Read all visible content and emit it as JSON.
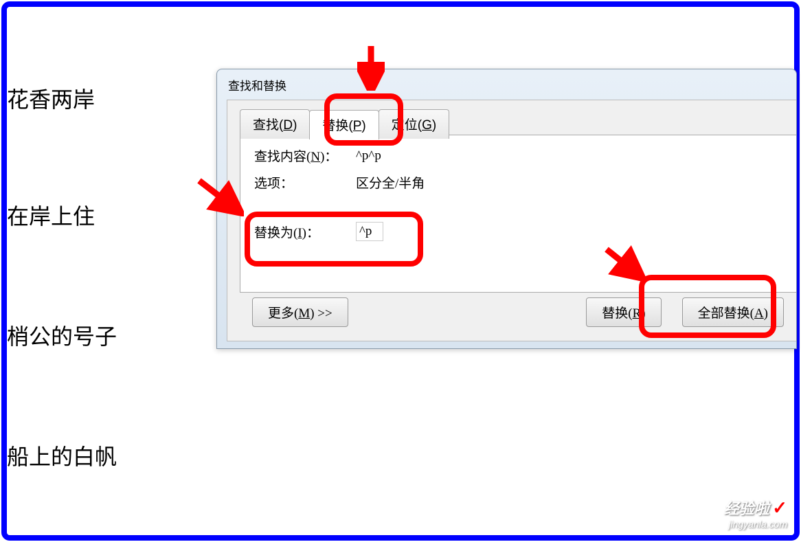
{
  "background_lines": {
    "line1": "花香两岸",
    "line2": "在岸上住",
    "line3": "梢公的号子",
    "line4": "船上的白帆"
  },
  "dialog": {
    "title": "查找和替换",
    "tabs": {
      "find": "查找(D)",
      "replace": "替换(P)",
      "goto": "定位(G)"
    },
    "labels": {
      "find_content": "查找内容(N)：",
      "options": "选项：",
      "replace_with": "替换为(I)："
    },
    "values": {
      "find_content": "^p^p",
      "options": "区分全/半角",
      "replace_with": "^p"
    },
    "buttons": {
      "more": "更多(M) >>",
      "replace": "替换(R)",
      "replace_all": "全部替换(A)"
    }
  },
  "watermark": {
    "top": "经验啦",
    "check": "✓",
    "bottom": "jingyanla.com"
  }
}
